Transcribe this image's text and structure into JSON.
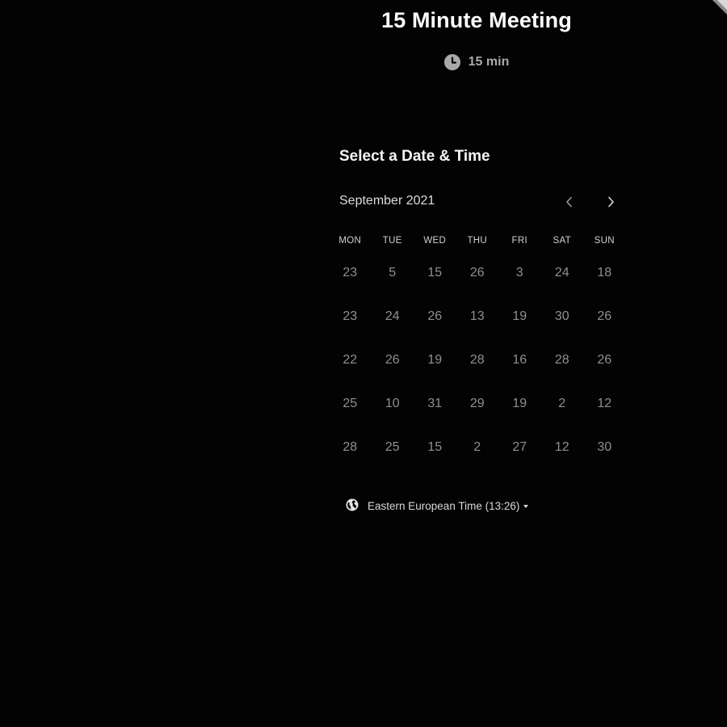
{
  "event": {
    "title": "15 Minute Meeting",
    "duration": "15 min",
    "duration_icon": "clock-icon"
  },
  "scheduler": {
    "heading": "Select a Date & Time",
    "month": "September 2021",
    "prev_icon": "chevron-left-icon",
    "next_icon": "chevron-right-icon",
    "weekdays": [
      "MON",
      "TUE",
      "WED",
      "THU",
      "FRI",
      "SAT",
      "SUN"
    ],
    "weeks": [
      [
        "23",
        "5",
        "15",
        "26",
        "3",
        "24",
        "18"
      ],
      [
        "23",
        "24",
        "26",
        "13",
        "19",
        "30",
        "26"
      ],
      [
        "22",
        "26",
        "19",
        "28",
        "16",
        "28",
        "26"
      ],
      [
        "25",
        "10",
        "31",
        "29",
        "19",
        "2",
        "12"
      ],
      [
        "28",
        "25",
        "15",
        "2",
        "27",
        "12",
        "30"
      ]
    ]
  },
  "timezone": {
    "label": "Eastern European Time (13:26)",
    "icon": "globe-icon"
  },
  "colors": {
    "background": "#030303",
    "text_primary": "#ffffff",
    "text_muted": "#8f8f8f"
  }
}
